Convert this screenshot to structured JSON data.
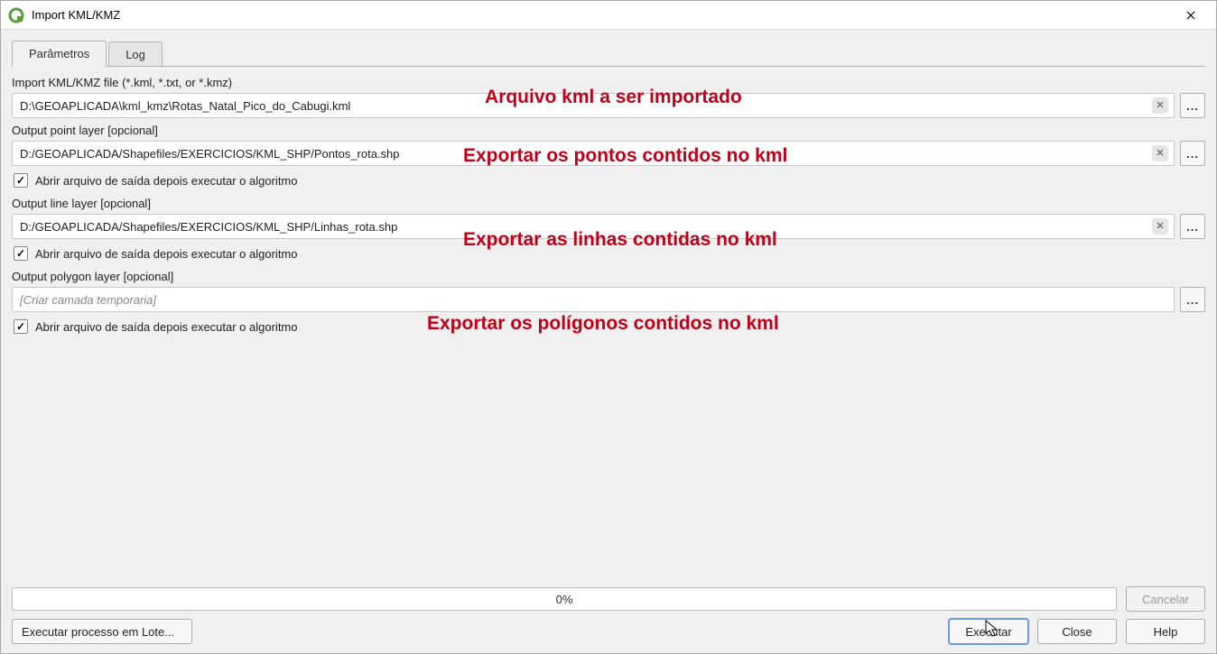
{
  "window": {
    "title": "Import KML/KMZ"
  },
  "tabs": {
    "parametros": "Parâmetros",
    "log": "Log"
  },
  "fields": {
    "import_label": "Import KML/KMZ file (*.kml, *.txt, or *.kmz)",
    "import_value": "D:\\GEOAPLICADA\\kml_kmz\\Rotas_Natal_Pico_do_Cabugi.kml",
    "point_label": "Output point layer [opcional]",
    "point_value": "D:/GEOAPLICADA/Shapefiles/EXERCICIOS/KML_SHP/Pontos_rota.shp",
    "line_label": "Output line layer [opcional]",
    "line_value": "D:/GEOAPLICADA/Shapefiles/EXERCICIOS/KML_SHP/Linhas_rota.shp",
    "polygon_label": "Output polygon layer [opcional]",
    "polygon_placeholder": "[Criar camada temporaria]",
    "open_after_label": "Abrir arquivo de saída depois executar o algoritmo"
  },
  "annotations": {
    "a1": "Arquivo kml a ser importado",
    "a2": "Exportar os pontos contidos no kml",
    "a3": "Exportar as linhas contidas no kml",
    "a4": "Exportar os polígonos contidos no kml"
  },
  "progress": {
    "text": "0%"
  },
  "buttons": {
    "cancel": "Cancelar",
    "batch": "Executar processo em Lote...",
    "execute": "Executar",
    "close": "Close",
    "help": "Help",
    "browse": "...",
    "clear": "✕"
  }
}
